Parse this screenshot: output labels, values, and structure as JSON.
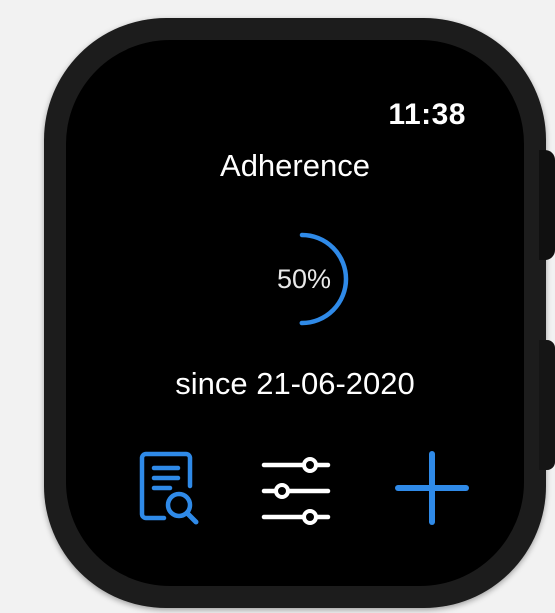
{
  "status_bar": {
    "time": "11:38"
  },
  "main": {
    "title": "Adherence",
    "progress": {
      "label": "50%",
      "value_percent": 50,
      "ring_color": "#2f8ae8"
    },
    "since_text": "since 21-06-2020"
  },
  "toolbar": {
    "buttons": [
      {
        "icon": "document-search-icon",
        "color": "#2f8ae8"
      },
      {
        "icon": "sliders-icon",
        "color": "#ffffff"
      },
      {
        "icon": "plus-icon",
        "color": "#2f8ae8"
      }
    ]
  }
}
